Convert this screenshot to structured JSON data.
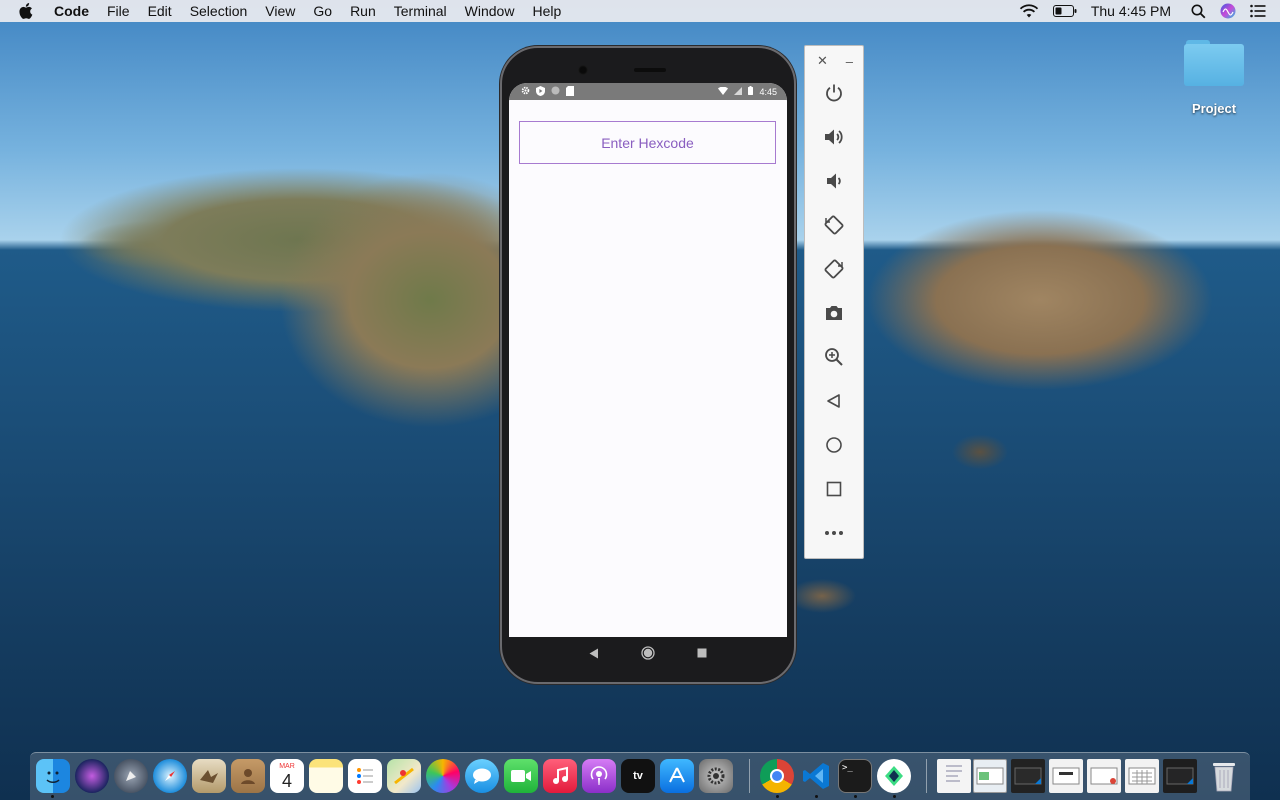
{
  "menubar": {
    "app_name": "Code",
    "items": [
      "File",
      "Edit",
      "Selection",
      "View",
      "Go",
      "Run",
      "Terminal",
      "Window",
      "Help"
    ],
    "clock": "Thu 4:45 PM",
    "status_icons": [
      "wifi-icon",
      "battery-icon",
      "spotlight-search-icon",
      "siri-icon",
      "control-center-icon"
    ]
  },
  "desktop": {
    "folder_label": "Project"
  },
  "phone": {
    "status_time": "4:45",
    "hex_input_placeholder": "Enter Hexcode",
    "nav_buttons": [
      "back-icon",
      "home-icon",
      "overview-icon"
    ]
  },
  "emulator_toolbar": {
    "buttons": [
      "power-icon",
      "volume-up-icon",
      "volume-down-icon",
      "rotate-left-icon",
      "rotate-right-icon",
      "screenshot-icon",
      "zoom-icon",
      "back-icon",
      "home-icon",
      "overview-icon",
      "more-icon"
    ]
  },
  "dock": {
    "calendar_month": "MAR",
    "calendar_day": "4",
    "tv_label": "tv",
    "apps": [
      "Finder",
      "Siri",
      "Launchpad",
      "Safari",
      "Mail",
      "Contacts",
      "Calendar",
      "Notes",
      "Reminders",
      "Maps",
      "Photos",
      "Messages",
      "FaceTime",
      "Music",
      "Podcasts",
      "TV",
      "App Store",
      "System Preferences",
      "Chrome",
      "Visual Studio Code",
      "Terminal",
      "Android Studio",
      "Preview",
      "Trash"
    ],
    "colors": {
      "finder": "#2a9ef0",
      "chrome": "#db4437",
      "vscode": "#0a78d4",
      "terminal": "#1b1b1b"
    }
  }
}
